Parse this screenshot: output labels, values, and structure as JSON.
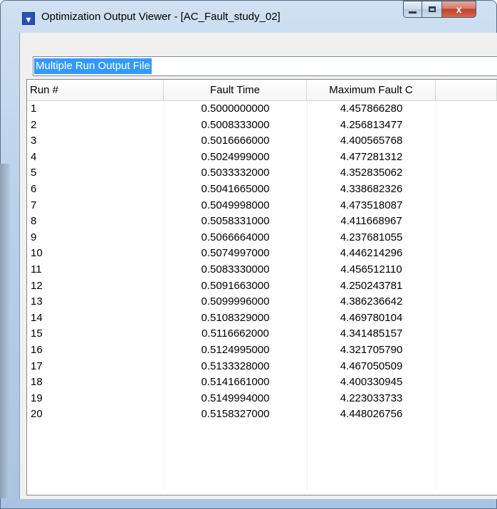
{
  "window": {
    "title": "Optimization Output Viewer - [AC_Fault_study_02]",
    "icon": "app-icon",
    "controls": {
      "minimize": "minimize-icon",
      "maximize": "maximize-icon",
      "close": "x"
    }
  },
  "file_label": "Multiple Run Output File",
  "table": {
    "headers": [
      "Run #",
      "Fault Time",
      "Maximum Fault C",
      ""
    ],
    "rows": [
      [
        "1",
        "0.5000000000",
        "4.457866280"
      ],
      [
        "2",
        "0.5008333000",
        "4.256813477"
      ],
      [
        "3",
        "0.5016666000",
        "4.400565768"
      ],
      [
        "4",
        "0.5024999000",
        "4.477281312"
      ],
      [
        "5",
        "0.5033332000",
        "4.352835062"
      ],
      [
        "6",
        "0.5041665000",
        "4.338682326"
      ],
      [
        "7",
        "0.5049998000",
        "4.473518087"
      ],
      [
        "8",
        "0.5058331000",
        "4.411668967"
      ],
      [
        "9",
        "0.5066664000",
        "4.237681055"
      ],
      [
        "10",
        "0.5074997000",
        "4.446214296"
      ],
      [
        "11",
        "0.5083330000",
        "4.456512110"
      ],
      [
        "12",
        "0.5091663000",
        "4.250243781"
      ],
      [
        "13",
        "0.5099996000",
        "4.386236642"
      ],
      [
        "14",
        "0.5108329000",
        "4.469780104"
      ],
      [
        "15",
        "0.5116662000",
        "4.341485157"
      ],
      [
        "16",
        "0.5124995000",
        "4.321705790"
      ],
      [
        "17",
        "0.5133328000",
        "4.467050509"
      ],
      [
        "18",
        "0.5141661000",
        "4.400330945"
      ],
      [
        "19",
        "0.5149994000",
        "4.223033733"
      ],
      [
        "20",
        "0.5158327000",
        "4.448026756"
      ]
    ]
  }
}
